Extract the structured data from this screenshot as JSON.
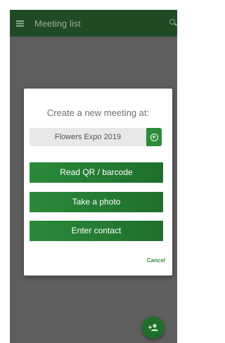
{
  "app_bar": {
    "title": "Meeting list",
    "menu_icon": "hamburger-menu-icon",
    "search_icon": "search-icon"
  },
  "dialog": {
    "title": "Create a new meeting at:",
    "event_value": "Flowers Expo 2019",
    "add_event_icon": "plus-circle-icon",
    "actions": [
      {
        "label": "Read QR / barcode"
      },
      {
        "label": "Take a photo"
      },
      {
        "label": "Enter contact"
      }
    ],
    "cancel_label": "Cancel"
  },
  "fab": {
    "icon": "add-person-icon"
  },
  "colors": {
    "app_bar": "#1f4a23",
    "accent": "#2c8c3b",
    "overlay": "#5e5e5e"
  }
}
